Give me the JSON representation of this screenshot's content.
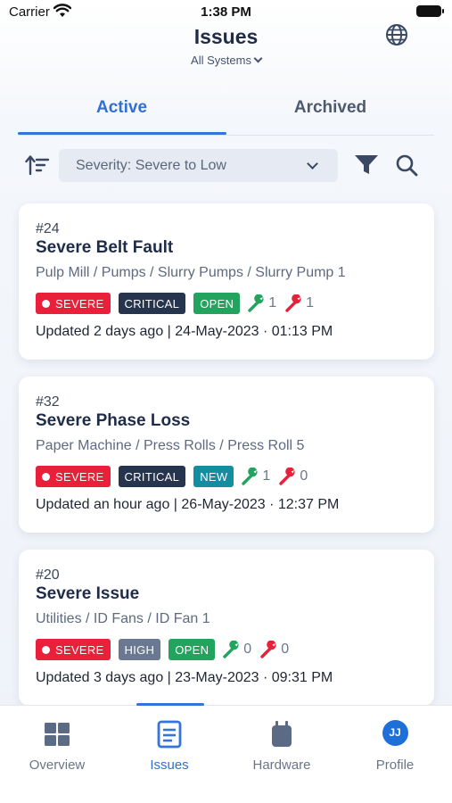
{
  "status_bar": {
    "carrier": "Carrier",
    "time": "1:38 PM"
  },
  "header": {
    "title": "Issues",
    "system_filter": "All Systems"
  },
  "tabs": [
    {
      "label": "Active",
      "selected": true
    },
    {
      "label": "Archived",
      "selected": false
    }
  ],
  "toolbar": {
    "sort_value": "Severity: Severe to Low"
  },
  "colors": {
    "accent": "#3574dc",
    "severe": "#ea1f3a",
    "critical": "#27344d",
    "high": "#6b7892",
    "open": "#22a35e",
    "new": "#148da0",
    "wrench_green": "#22a35e",
    "wrench_red": "#ea1f3a"
  },
  "issues": [
    {
      "number": "#24",
      "title": "Severe Belt Fault",
      "path": "Pulp Mill / Pumps / Slurry Pumps / Slurry Pump 1",
      "severity": "SEVERE",
      "priority": "CRITICAL",
      "status": "OPEN",
      "green_count": "1",
      "red_count": "1",
      "updated": "Updated 2 days ago | 24-May-2023 · 01:13 PM"
    },
    {
      "number": "#32",
      "title": "Severe Phase Loss",
      "path": "Paper Machine / Press Rolls / Press Roll 5",
      "severity": "SEVERE",
      "priority": "CRITICAL",
      "status": "NEW",
      "green_count": "1",
      "red_count": "0",
      "updated": "Updated an hour ago | 26-May-2023 · 12:37 PM"
    },
    {
      "number": "#20",
      "title": "Severe Issue",
      "path": "Utilities / ID Fans / ID Fan 1",
      "severity": "SEVERE",
      "priority": "HIGH",
      "status": "OPEN",
      "green_count": "0",
      "red_count": "0",
      "updated": "Updated 3 days ago | 23-May-2023 · 09:31 PM"
    }
  ],
  "bottom_nav": [
    {
      "label": "Overview",
      "icon": "grid-icon"
    },
    {
      "label": "Issues",
      "icon": "document-icon",
      "selected": true
    },
    {
      "label": "Hardware",
      "icon": "device-icon"
    },
    {
      "label": "Profile",
      "avatar_initials": "JJ"
    }
  ]
}
